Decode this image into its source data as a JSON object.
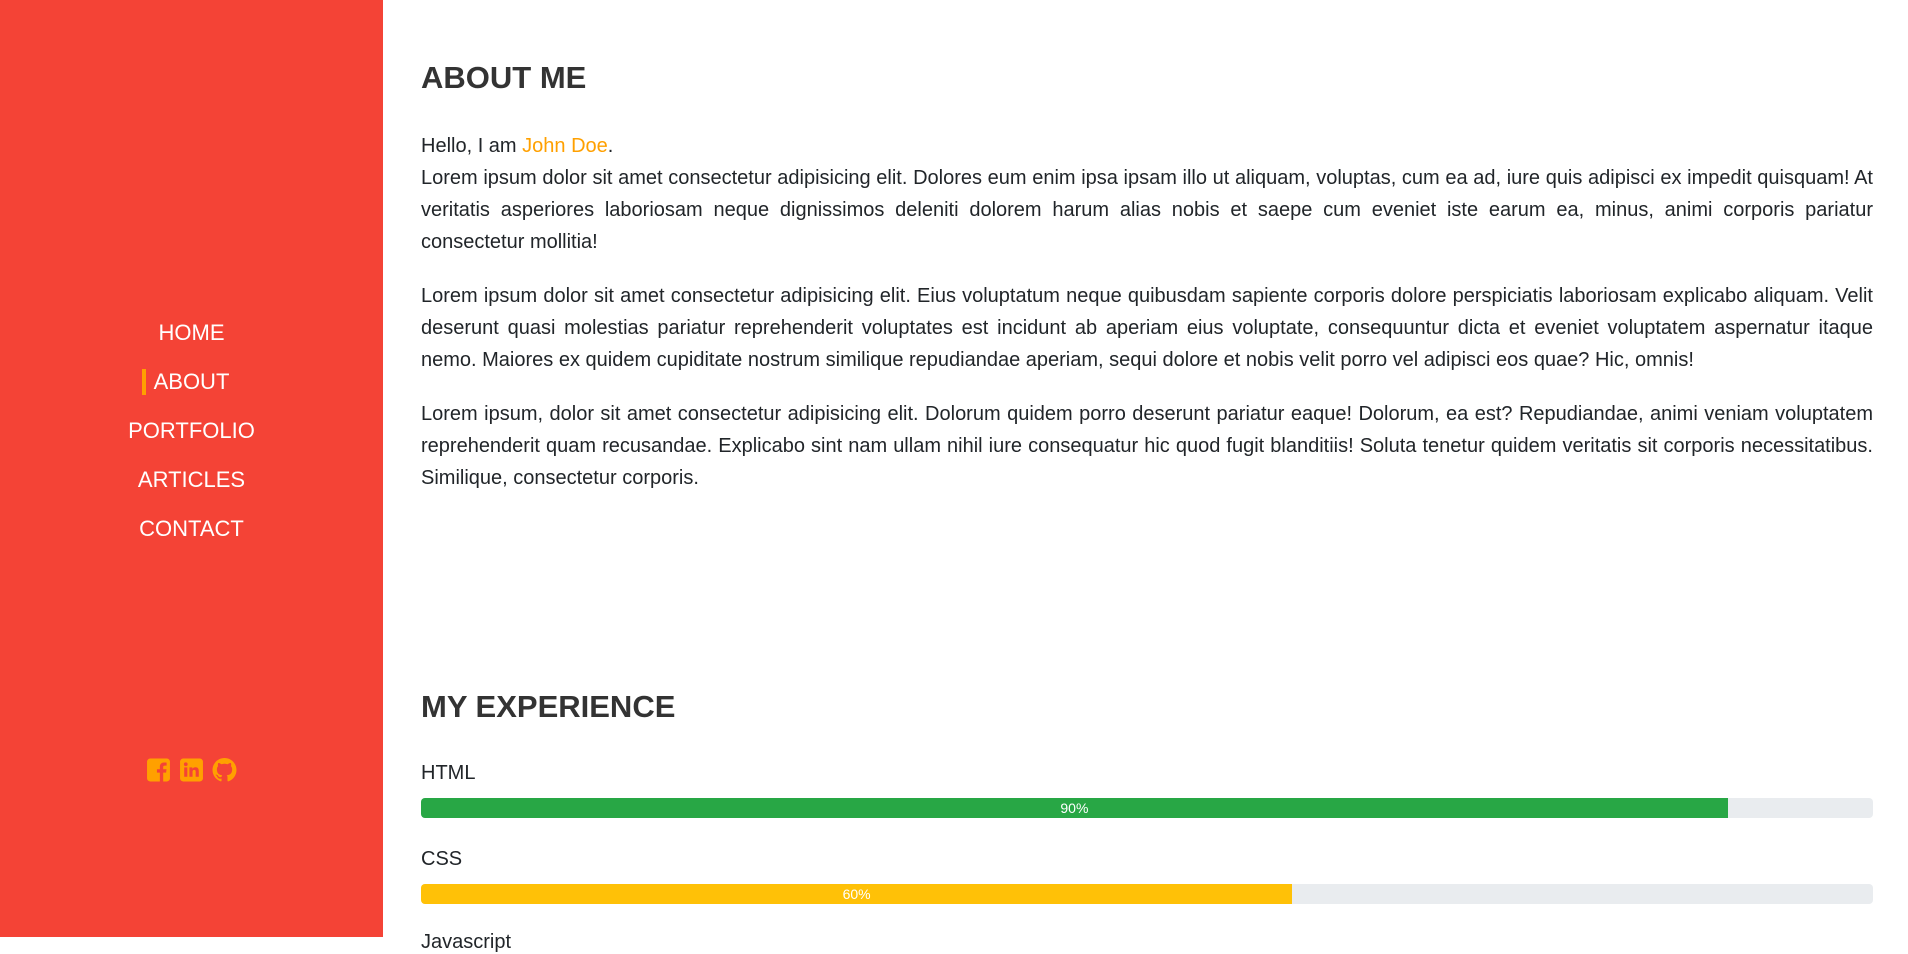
{
  "nav": {
    "items": [
      {
        "label": "HOME"
      },
      {
        "label": "ABOUT",
        "active": true
      },
      {
        "label": "PORTFOLIO"
      },
      {
        "label": "ARTICLES"
      },
      {
        "label": "CONTACT"
      }
    ]
  },
  "social": {
    "icons": [
      "facebook-icon",
      "linkedin-icon",
      "github-icon"
    ],
    "color": "#ffa000"
  },
  "about": {
    "title": "ABOUT ME",
    "greeting_prefix": "Hello, I am ",
    "name": "John Doe",
    "greeting_suffix": ".",
    "p1": "Lorem ipsum dolor sit amet consectetur adipisicing elit. Dolores eum enim ipsa ipsam illo ut aliquam, voluptas, cum ea ad, iure quis adipisci ex impedit quisquam! At veritatis asperiores laboriosam neque dignissimos deleniti dolorem harum alias nobis et saepe cum eveniet iste earum ea, minus, animi corporis pariatur consectetur mollitia!",
    "p2": "Lorem ipsum dolor sit amet consectetur adipisicing elit. Eius voluptatum neque quibusdam sapiente corporis dolore perspiciatis laboriosam explicabo aliquam. Velit deserunt quasi molestias pariatur reprehenderit voluptates est incidunt ab aperiam eius voluptate, consequuntur dicta et eveniet voluptatem aspernatur itaque nemo. Maiores ex quidem cupiditate nostrum similique repudiandae aperiam, sequi dolore et nobis velit porro vel adipisci eos quae? Hic, omnis!",
    "p3": "Lorem ipsum, dolor sit amet consectetur adipisicing elit. Dolorum quidem porro deserunt pariatur eaque! Dolorum, ea est? Repudiandae, animi veniam voluptatem reprehenderit quam recusandae. Explicabo sint nam ullam nihil iure consequatur hic quod fugit blanditiis! Soluta tenetur quidem veritatis sit corporis necessitatibus. Similique, consectetur corporis."
  },
  "experience": {
    "title": "MY EXPERIENCE",
    "skills": [
      {
        "label": "HTML",
        "percent": 90,
        "percent_label": "90%",
        "color": "#28a745"
      },
      {
        "label": "CSS",
        "percent": 60,
        "percent_label": "60%",
        "color": "#ffc107"
      },
      {
        "label": "Javascript"
      }
    ]
  },
  "colors": {
    "sidebar": "#f44336",
    "accent": "#ffa000",
    "track": "#e9ecef"
  }
}
